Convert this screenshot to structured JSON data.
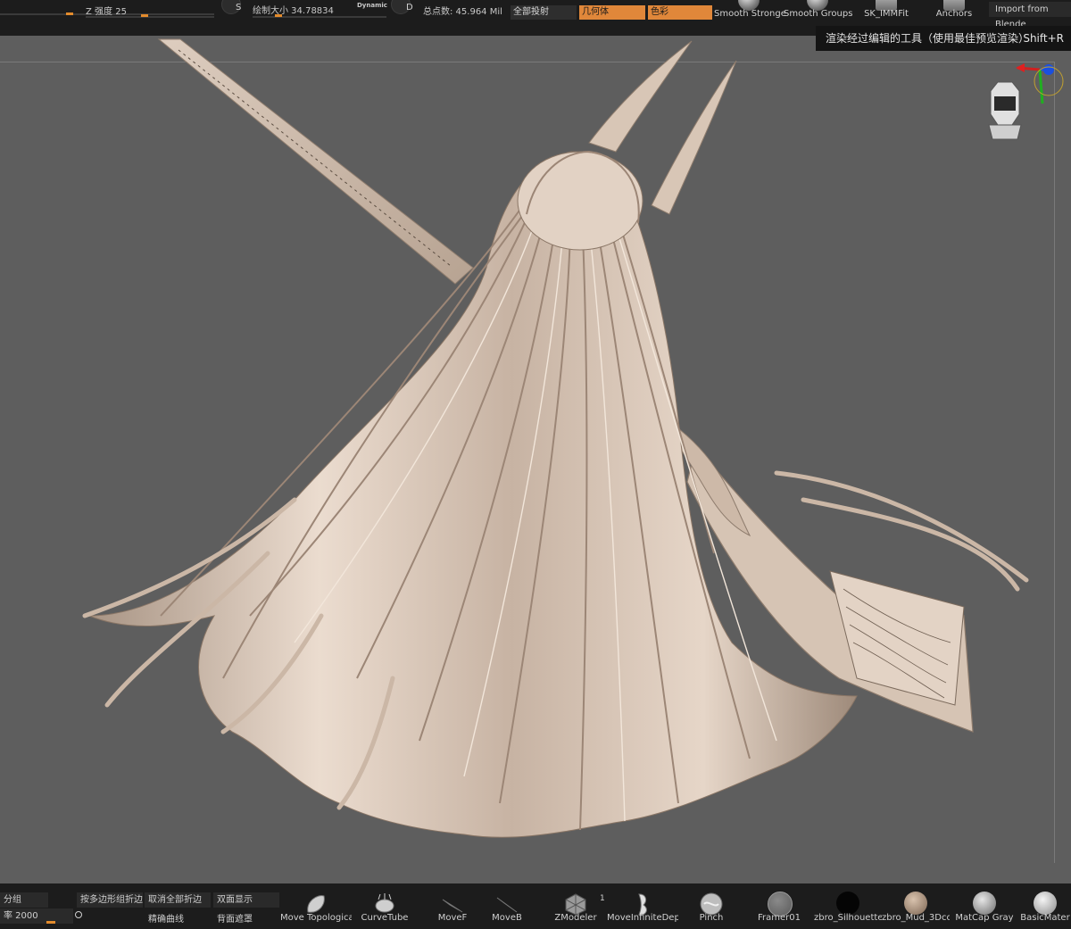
{
  "top_bar": {
    "z_intensity": "Z 强度 25",
    "draw_size": "绘制大小 34.78834",
    "dynamic": "Dynamic",
    "mode_s": "S",
    "mode_d": "D",
    "total_points": "总点数: 45.964 Mil",
    "projection_dropdown": "全部投射",
    "geometry_dropdown": "几何体",
    "color_dropdown": "色彩",
    "brushes": [
      "Smooth Stronge",
      "Smooth Groups",
      "SK_IMMFit",
      "Anchors"
    ],
    "import_button": "Import from Blende"
  },
  "tooltip": {
    "text": "渲染经过编辑的工具（使用最佳预览渲染）",
    "shortcut": "Shift+R"
  },
  "bottom_bar": {
    "group_field": "分组",
    "rate_field": "率 2000",
    "crease_by_polygroup": "按多边形组折边",
    "uncrease_all": "取消全部折边",
    "double_sided": "双面显示",
    "precise_curve": "精确曲线",
    "back_mask": "背面遮罩",
    "brushes": [
      {
        "label": "Move Topologica",
        "icon": "move-topological-brush-icon"
      },
      {
        "label": "CurveTube",
        "icon": "curvetube-brush-icon"
      },
      {
        "label": "MoveF",
        "icon": "move-brush-icon"
      },
      {
        "label": "MoveB",
        "icon": "move-brush-icon"
      },
      {
        "label": "ZModeler",
        "icon": "zmodeler-brush-icon"
      },
      {
        "label": "MoveInfiniteDep",
        "icon": "move-infinite-depth-brush-icon"
      },
      {
        "label": "Pinch",
        "icon": "pinch-brush-icon"
      }
    ],
    "zmodeler_badge": "1",
    "materials": [
      {
        "label": "Framer01",
        "color": "#6a6a6a"
      },
      {
        "label": "zbro_Silhouette",
        "color": "#050505"
      },
      {
        "label": "zbro_Mud_3Dcoa",
        "color": "#a08a76"
      },
      {
        "label": "MatCap Gray",
        "color": "#9a9a9a"
      },
      {
        "label": "BasicMater",
        "color": "#b8b8b8"
      }
    ]
  },
  "canvas": {
    "background_color": "#5e5e5e",
    "model_color": "#d9c6b6"
  }
}
